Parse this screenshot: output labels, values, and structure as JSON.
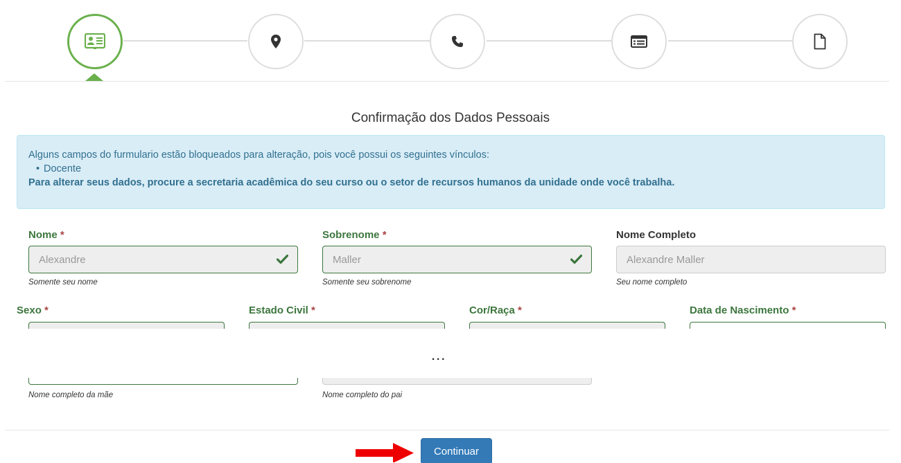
{
  "stepper": {
    "steps": [
      {
        "icon": "id-card-icon",
        "state": "active"
      },
      {
        "icon": "map-marker-icon",
        "state": "inactive"
      },
      {
        "icon": "phone-icon",
        "state": "inactive"
      },
      {
        "icon": "list-alt-icon",
        "state": "inactive"
      },
      {
        "icon": "file-icon",
        "state": "inactive"
      }
    ],
    "active_color": "#6ab04c"
  },
  "page": {
    "title": "Confirmação dos Dados Pessoais"
  },
  "alert": {
    "intro": "Alguns campos do furmulario estão bloqueados para alteração, pois você possui os seguintes vínculos:",
    "items": [
      "Docente"
    ],
    "instruction": "Para alterar seus dados, procure a secretaria acadêmica do seu curso ou o setor de recursos humanos da unidade onde você trabalha."
  },
  "form": {
    "nome": {
      "label": "Nome",
      "required": "*",
      "value": "Alexandre",
      "help": "Somente seu nome"
    },
    "sobrenome": {
      "label": "Sobrenome",
      "required": "*",
      "value": "Maller",
      "help": "Somente seu sobrenome"
    },
    "nome_completo": {
      "label": "Nome Completo",
      "value": "Alexandre Maller",
      "help": "Seu nome completo"
    },
    "sexo": {
      "label": "Sexo",
      "required": "*"
    },
    "estado_civil": {
      "label": "Estado Civil",
      "required": "*"
    },
    "cor_raca": {
      "label": "Cor/Raça",
      "required": "*"
    },
    "data_nascimento": {
      "label": "Data de Nascimento",
      "required": "*"
    },
    "nome_mae": {
      "help": "Nome completo da mãe"
    },
    "nome_pai": {
      "help": "Nome completo do pai"
    }
  },
  "ellipsis": "...",
  "actions": {
    "continue_label": "Continuar"
  },
  "colors": {
    "success": "#3c763d",
    "required": "#a94442",
    "info_bg": "#d9edf7",
    "info_text": "#31708f",
    "primary": "#337ab7",
    "annotation_arrow": "#ee0000"
  }
}
